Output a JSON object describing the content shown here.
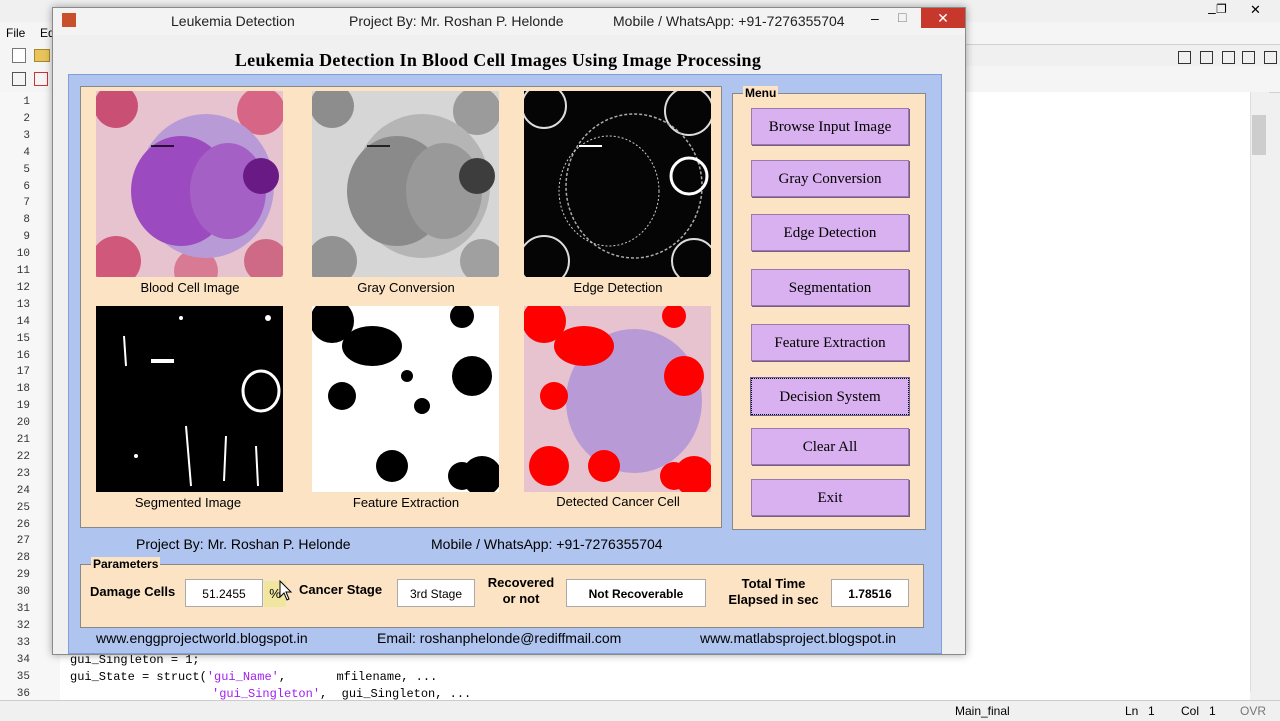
{
  "editor": {
    "menu_file": "File",
    "menu_edit": "Ed",
    "line_numbers": [
      "1",
      "2",
      "3",
      "4",
      "5",
      "6",
      "7",
      "8",
      "9",
      "10",
      "11",
      "12",
      "13",
      "14",
      "15",
      "16",
      "17",
      "18",
      "19",
      "20",
      "21",
      "22",
      "23",
      "24",
      "25",
      "26",
      "27",
      "28",
      "29",
      "30",
      "31",
      "32",
      "33",
      "34",
      "35",
      "36"
    ],
    "code_line_34": "gui_Singleton = 1;",
    "code_line_35_a": "gui_State = struct(",
    "code_line_35_b": "'gui_Name'",
    "code_line_35_c": ",       mfilename, ...",
    "code_line_36_a": "'gui_Singleton'",
    "code_line_36_b": ",  gui_Singleton, ...",
    "status_file": "Main_final",
    "status_ln_label": "Ln",
    "status_ln": "1",
    "status_col_label": "Col",
    "status_col": "1",
    "status_ovr": "OVR"
  },
  "window": {
    "title": "Leukemia Detection",
    "project_by": "Project By: Mr. Roshan P. Helonde",
    "mobile": "Mobile / WhatsApp: +91-7276355704",
    "minimize": "–",
    "maximize": "□",
    "close": "✕"
  },
  "main_title": "Leukemia Detection In Blood Cell Images Using Image Processing",
  "images": {
    "blood_cell": "Blood Cell Image",
    "gray": "Gray Conversion",
    "edge": "Edge Detection",
    "segmented": "Segmented Image",
    "feature": "Feature Extraction",
    "cancer": "Detected Cancer Cell"
  },
  "menu": {
    "label": "Menu",
    "buttons": [
      "Browse Input Image",
      "Gray Conversion",
      "Edge Detection",
      "Segmentation",
      "Feature Extraction",
      "Decision System",
      "Clear All",
      "Exit"
    ]
  },
  "project_line": {
    "by": "Project By: Mr. Roshan P. Helonde",
    "mobile": "Mobile / WhatsApp: +91-7276355704"
  },
  "parameters": {
    "label": "Parameters",
    "damage_label": "Damage Cells",
    "damage_value": "51.2455",
    "percent": "%",
    "stage_label": "Cancer Stage",
    "stage_value": "3rd Stage",
    "recovered_label_1": "Recovered",
    "recovered_label_2": "or not",
    "recovered_value": "Not Recoverable",
    "time_label_1": "Total Time",
    "time_label_2": "Elapsed in sec",
    "time_value": "1.78516"
  },
  "footer": {
    "site1": "www.enggprojectworld.blogspot.in",
    "email": "Email: roshanphelonde@rediffmail.com",
    "site2": "www.matlabsproject.blogspot.in"
  }
}
